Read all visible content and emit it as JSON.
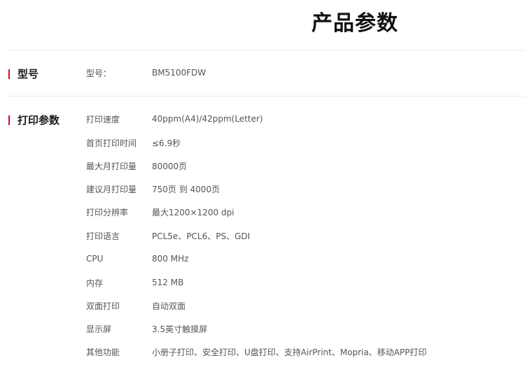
{
  "page": {
    "title": "产品参数"
  },
  "sections": {
    "model": {
      "label": "型号",
      "rows": [
        {
          "key": "型号：",
          "value": "BM5100FDW"
        }
      ]
    },
    "print": {
      "label": "打印参数",
      "rows": [
        {
          "key": "打印速度",
          "value": "40ppm(A4)/42ppm(Letter)"
        },
        {
          "key": "首页打印时间",
          "value": "≤6.9秒"
        },
        {
          "key": "最大月打印量",
          "value": "80000页"
        },
        {
          "key": "建议月打印量",
          "value": "750页 到 4000页"
        },
        {
          "key": "打印分辨率",
          "value": "最大1200×1200 dpi"
        },
        {
          "key": "打印语言",
          "value": "PCL5e、PCL6、PS、GDI"
        },
        {
          "key": "CPU",
          "value": "800 MHz"
        },
        {
          "key": "内存",
          "value": "512 MB"
        },
        {
          "key": "双面打印",
          "value": "自动双面"
        },
        {
          "key": "显示屏",
          "value": "3.5英寸触摸屏"
        },
        {
          "key": "其他功能",
          "value": "小册子打印、安全打印、U盘打印、支持AirPrint、Mopria、移动APP打印"
        }
      ]
    }
  },
  "colors": {
    "accent": "#c8102e",
    "divider": "#ececec",
    "text": "#555555",
    "heading": "#111111"
  }
}
